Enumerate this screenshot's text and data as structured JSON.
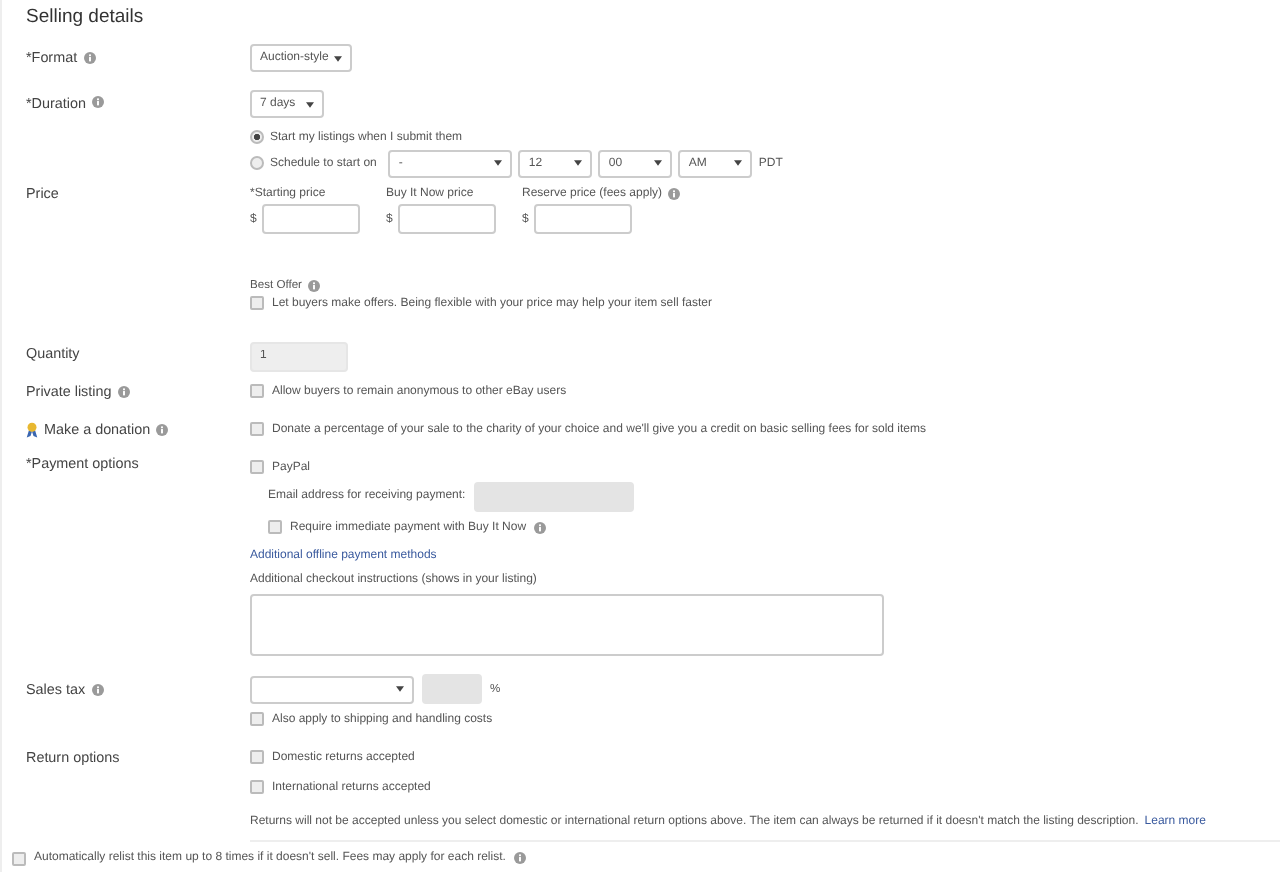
{
  "title": "Selling details",
  "format": {
    "label": "*Format",
    "info": true,
    "value": "Auction-style"
  },
  "duration": {
    "label": "*Duration",
    "info": true,
    "value": "7 days"
  },
  "start_options": [
    {
      "label": "Start my listings when I submit them",
      "selected": true
    },
    {
      "label": "Schedule to start on",
      "selected": false
    }
  ],
  "schedule": {
    "date": "-",
    "hour": "12",
    "minute": "00",
    "meridiem": "AM",
    "timezone": "PDT"
  },
  "price": {
    "label": "Price",
    "fields": [
      {
        "label": "*Starting price",
        "info": false,
        "currency": "$"
      },
      {
        "label": "Buy It Now price",
        "info": false,
        "currency": "$"
      },
      {
        "label": "Reserve price (fees apply)",
        "info": true,
        "currency": "$"
      }
    ]
  },
  "best_offer": {
    "label": "Best Offer",
    "info": true,
    "checkbox": {
      "label": "Let buyers make offers. Being flexible with your price may help your item sell faster",
      "checked": false
    }
  },
  "quantity": {
    "label": "Quantity",
    "value": "1"
  },
  "private_listing": {
    "label": "Private listing",
    "info": true,
    "checkbox": {
      "label": "Allow buyers to remain anonymous to other eBay users",
      "checked": false
    }
  },
  "donation": {
    "label": "Make a donation",
    "info": true,
    "checkbox": {
      "label": "Donate a percentage of your sale to the charity of your choice and we'll give you a credit on basic selling fees for sold items",
      "checked": false
    }
  },
  "payment": {
    "label": "*Payment options",
    "paypal": {
      "label": "PayPal",
      "checked": false
    },
    "email_label": "Email address for receiving payment:",
    "immediate": {
      "label": "Require immediate payment with Buy It Now",
      "checked": false,
      "info": true
    },
    "offline_link": "Additional offline payment methods",
    "instructions_label": "Additional checkout instructions (shows in your listing)"
  },
  "sales_tax": {
    "label": "Sales tax",
    "info": true,
    "percent_sign": "%",
    "checkbox": {
      "label": "Also apply to shipping and handling costs",
      "checked": false
    }
  },
  "returns": {
    "label": "Return options",
    "options": [
      {
        "label": "Domestic returns accepted",
        "checked": false
      },
      {
        "label": "International returns accepted",
        "checked": false
      }
    ],
    "note": "Returns will not be accepted unless you select domestic or international return options above. The item can always be returned if it doesn't match the listing description.",
    "learn_more": "Learn more"
  },
  "relist": {
    "label": "Automatically relist this item up to 8 times if it doesn't sell. Fees may apply for each relist.",
    "checked": false,
    "info": true
  }
}
